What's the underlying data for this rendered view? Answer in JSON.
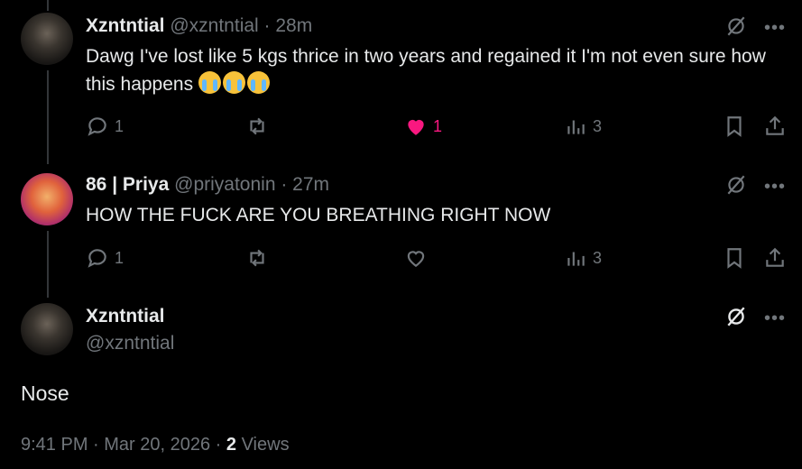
{
  "tweets": [
    {
      "name": "Xzntntial",
      "handle": "@xzntntial",
      "time": "· 28m",
      "text": "Dawg I've lost like 5 kgs thrice in two years and regained it I'm not even sure how this happens",
      "emojis": [
        "loudly-crying-face",
        "loudly-crying-face",
        "loudly-crying-face"
      ],
      "replies": "1",
      "retweets": "",
      "likes": "1",
      "liked": true,
      "views": "3"
    },
    {
      "name": "86 | Priya",
      "handle": "@priyatonin",
      "time": "· 27m",
      "text": "HOW THE FUCK ARE YOU BREATHING RIGHT NOW",
      "replies": "1",
      "retweets": "",
      "likes": "",
      "liked": false,
      "views": "3"
    }
  ],
  "main": {
    "name": "Xzntntial",
    "handle": "@xzntntial",
    "text": "Nose",
    "timestamp": "9:41 PM · Mar 20, 2026 · ",
    "views_count": "2",
    "views_label": "Views"
  },
  "colors": {
    "background": "#000000",
    "text": "#e7e9ea",
    "muted": "#71767b",
    "like": "#f91880"
  }
}
